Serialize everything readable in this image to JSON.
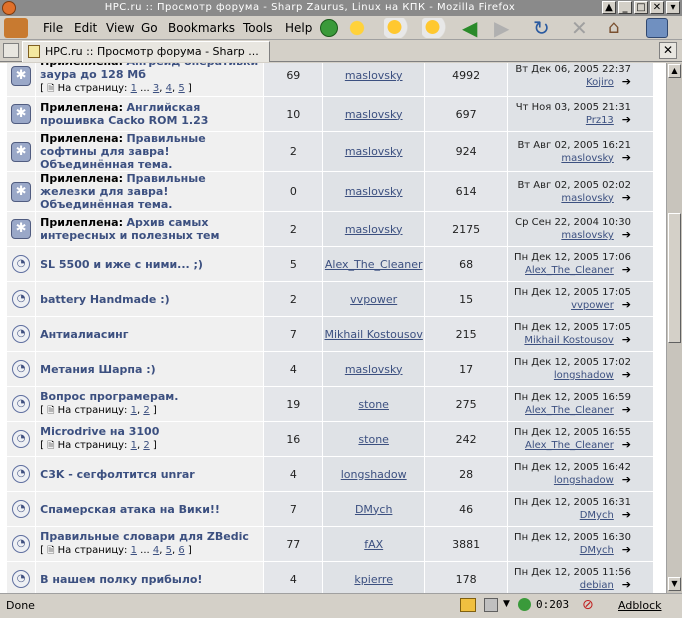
{
  "window": {
    "title": "HPC.ru :: Просмотр форума - Sharp Zaurus, Linux на КПК - Mozilla Firefox"
  },
  "menu": [
    "File",
    "Edit",
    "View",
    "Go",
    "Bookmarks",
    "Tools",
    "Help"
  ],
  "tab": {
    "label": "HPC.ru :: Просмотр форума - Sharp ..."
  },
  "topics": [
    {
      "icon": "sticky-icon",
      "prefix": "Прилеплена:",
      "title": "Апгрейд оперативки заура до 128 Мб",
      "pages_label": "На страницу:",
      "pages": [
        "1",
        "...",
        "3",
        "4",
        "5"
      ],
      "replies": "69",
      "author": "maslovsky",
      "views": "4992",
      "last_date": "Вт Дек 06, 2005 22:37",
      "last_user": "Kojiro"
    },
    {
      "icon": "sticky-icon",
      "prefix": "Прилеплена:",
      "title": "Английская прошивка Cacko ROM 1.23",
      "pages_label": "",
      "pages": [],
      "replies": "10",
      "author": "maslovsky",
      "views": "697",
      "last_date": "Чт Ноя 03, 2005 21:31",
      "last_user": "Prz13"
    },
    {
      "icon": "sticky-icon",
      "prefix": "Прилеплена:",
      "title": "Правильные софтины для завра! Объединённая тема.",
      "pages_label": "",
      "pages": [],
      "replies": "2",
      "author": "maslovsky",
      "views": "924",
      "last_date": "Вт Авг 02, 2005 16:21",
      "last_user": "maslovsky"
    },
    {
      "icon": "sticky-icon",
      "prefix": "Прилеплена:",
      "title": "Правильные железки для завра! Объединённая тема.",
      "pages_label": "",
      "pages": [],
      "replies": "0",
      "author": "maslovsky",
      "views": "614",
      "last_date": "Вт Авг 02, 2005 02:02",
      "last_user": "maslovsky"
    },
    {
      "icon": "sticky-icon",
      "prefix": "Прилеплена:",
      "title": "Архив самых интересных и полезных тем",
      "pages_label": "",
      "pages": [],
      "replies": "2",
      "author": "maslovsky",
      "views": "2175",
      "last_date": "Ср Сен 22, 2004 10:30",
      "last_user": "maslovsky"
    },
    {
      "icon": "topic-icon",
      "prefix": "",
      "title": "SL 5500 и иже с ними... ;)",
      "pages_label": "",
      "pages": [],
      "replies": "5",
      "author": "Alex_The_Cleaner",
      "views": "68",
      "last_date": "Пн Дек 12, 2005 17:06",
      "last_user": "Alex_The_Cleaner"
    },
    {
      "icon": "topic-icon",
      "prefix": "",
      "title": "battery Handmade :)",
      "pages_label": "",
      "pages": [],
      "replies": "2",
      "author": "vvpower",
      "views": "15",
      "last_date": "Пн Дек 12, 2005 17:05",
      "last_user": "vvpower"
    },
    {
      "icon": "topic-icon",
      "prefix": "",
      "title": "Антиалиасинг",
      "pages_label": "",
      "pages": [],
      "replies": "7",
      "author": "Mikhail Kostousov",
      "views": "215",
      "last_date": "Пн Дек 12, 2005 17:05",
      "last_user": "Mikhail Kostousov"
    },
    {
      "icon": "topic-icon",
      "prefix": "",
      "title": "Метания Шарпа :)",
      "pages_label": "",
      "pages": [],
      "replies": "4",
      "author": "maslovsky",
      "views": "17",
      "last_date": "Пн Дек 12, 2005 17:02",
      "last_user": "longshadow"
    },
    {
      "icon": "topic-icon",
      "prefix": "",
      "title": "Вопрос програмерам.",
      "pages_label": "На страницу:",
      "pages": [
        "1",
        "2"
      ],
      "replies": "19",
      "author": "stone",
      "views": "275",
      "last_date": "Пн Дек 12, 2005 16:59",
      "last_user": "Alex_The_Cleaner"
    },
    {
      "icon": "topic-icon",
      "prefix": "",
      "title": "Microdrive на 3100",
      "pages_label": "На страницу:",
      "pages": [
        "1",
        "2"
      ],
      "replies": "16",
      "author": "stone",
      "views": "242",
      "last_date": "Пн Дек 12, 2005 16:55",
      "last_user": "Alex_The_Cleaner"
    },
    {
      "icon": "topic-icon",
      "prefix": "",
      "title": "C3K - сегфолтится unrar",
      "pages_label": "",
      "pages": [],
      "replies": "4",
      "author": "longshadow",
      "views": "28",
      "last_date": "Пн Дек 12, 2005 16:42",
      "last_user": "longshadow"
    },
    {
      "icon": "topic-icon",
      "prefix": "",
      "title": "Спамерская атака на Вики!!",
      "pages_label": "",
      "pages": [],
      "replies": "7",
      "author": "DMych",
      "views": "46",
      "last_date": "Пн Дек 12, 2005 16:31",
      "last_user": "DMych"
    },
    {
      "icon": "topic-icon",
      "prefix": "",
      "title": "Правильные словари для ZBedic",
      "pages_label": "На страницу:",
      "pages": [
        "1",
        "...",
        "4",
        "5",
        "6"
      ],
      "replies": "77",
      "author": "fAX",
      "views": "3881",
      "last_date": "Пн Дек 12, 2005 16:30",
      "last_user": "DMych"
    },
    {
      "icon": "topic-icon",
      "prefix": "",
      "title": "В нашем полку прибыло!",
      "pages_label": "",
      "pages": [],
      "replies": "4",
      "author": "kpierre",
      "views": "178",
      "last_date": "Пн Дек 12, 2005 11:56",
      "last_user": "debian"
    }
  ],
  "status": {
    "text": "Done",
    "time": "0:203",
    "adblock": "Adblock"
  }
}
